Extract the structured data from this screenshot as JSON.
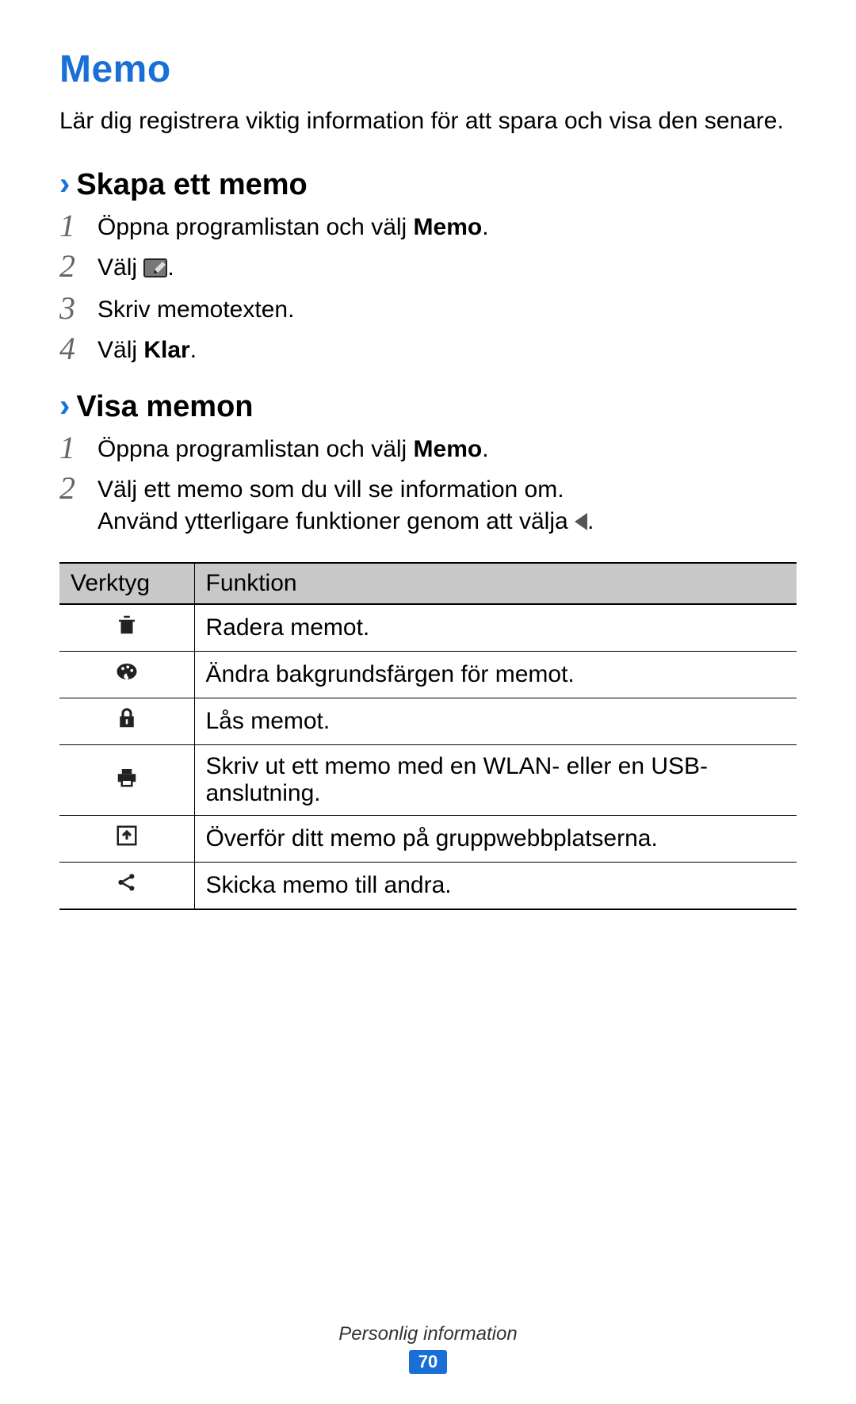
{
  "title": "Memo",
  "intro": "Lär dig registrera viktig information för att spara och visa den senare.",
  "section1": {
    "heading": "Skapa ett memo",
    "steps": {
      "s1_pre": "Öppna programlistan och välj ",
      "s1_bold": "Memo",
      "s1_post": ".",
      "s2_pre": "Välj ",
      "s2_post": ".",
      "s3": "Skriv memotexten.",
      "s4_pre": "Välj ",
      "s4_bold": "Klar",
      "s4_post": "."
    }
  },
  "section2": {
    "heading": "Visa memon",
    "steps": {
      "s1_pre": "Öppna programlistan och välj ",
      "s1_bold": "Memo",
      "s1_post": ".",
      "s2_line1": "Välj ett memo som du vill se information om.",
      "s2_line2_pre": "Använd ytterligare funktioner genom att välja ",
      "s2_line2_post": "."
    }
  },
  "table": {
    "header_tool": "Verktyg",
    "header_func": "Funktion",
    "rows": {
      "r1": "Radera memot.",
      "r2": "Ändra bakgrundsfärgen för memot.",
      "r3": "Lås memot.",
      "r4": "Skriv ut ett memo med en WLAN- eller en USB-anslutning.",
      "r5": "Överför ditt memo på gruppwebbplatserna.",
      "r6": "Skicka memo till andra."
    }
  },
  "footer": {
    "section_label": "Personlig information",
    "page_number": "70"
  }
}
